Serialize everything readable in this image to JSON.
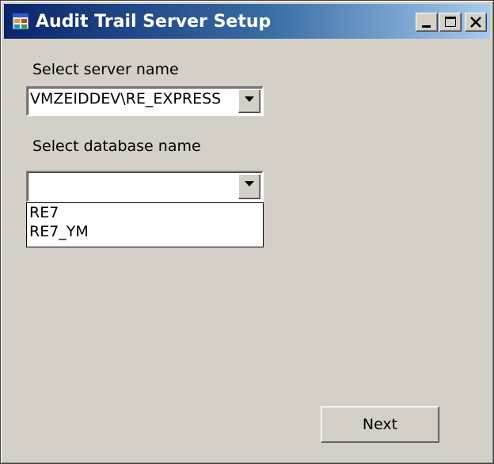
{
  "window": {
    "title": "Audit Trail Server Setup"
  },
  "form": {
    "server_label": "Select server name",
    "server_value": "VMZEIDDEV\\RE_EXPRESS",
    "database_label": "Select database name",
    "database_value": "",
    "database_options": [
      "RE7",
      "RE7_YM"
    ],
    "next_label": "Next"
  },
  "icons": {
    "app": "app-window-icon",
    "minimize": "minimize-icon",
    "maximize": "maximize-icon",
    "close": "close-icon",
    "dropdown": "chevron-down-icon"
  }
}
